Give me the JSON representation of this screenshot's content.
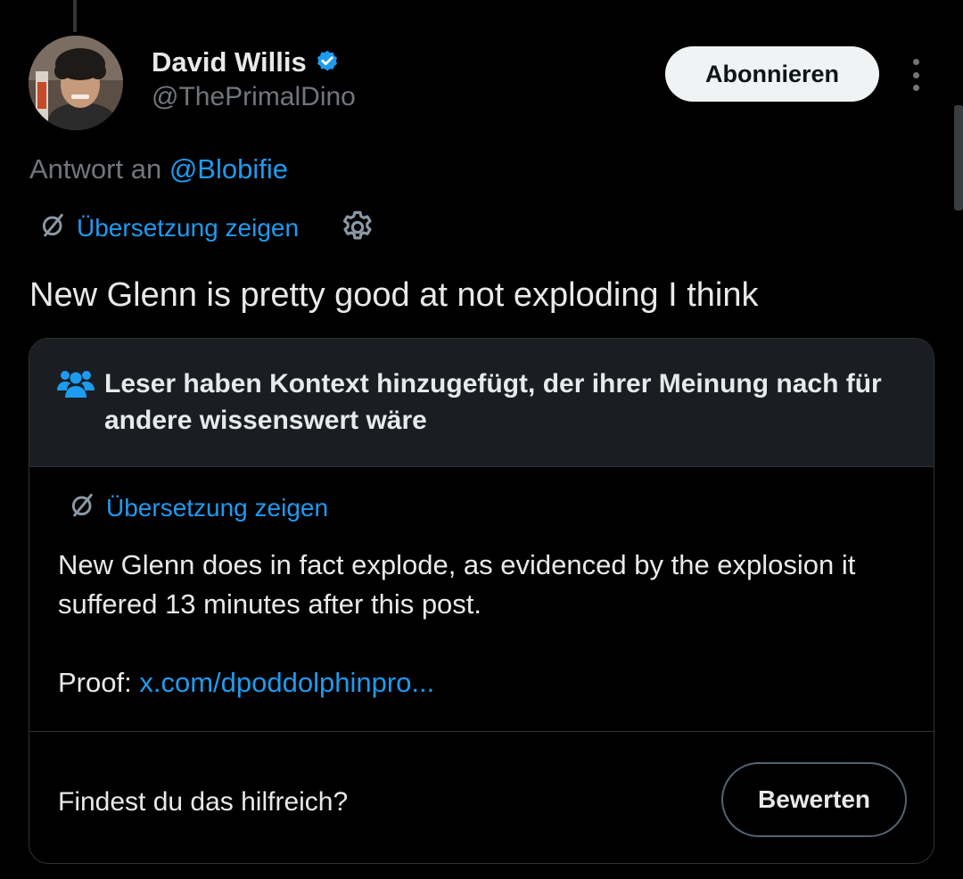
{
  "post": {
    "author_name": "David Willis",
    "handle": "@ThePrimalDino",
    "follow_label": "Abonnieren",
    "reply_prefix": "Antwort an",
    "reply_mention": "@Blobifie",
    "translate_label": "Übersetzung zeigen",
    "text": "New Glenn is pretty good at not exploding I think"
  },
  "community_note": {
    "title": "Leser haben Kontext hinzugefügt, der ihrer Meinung nach für andere wissenswert wäre",
    "translate_label": "Übersetzung zeigen",
    "body": "New Glenn does in fact explode, as evidenced by the explosion it suffered 13 minutes after this post.",
    "proof_label": "Proof:",
    "proof_link": "x.com/dpoddolphinpro...",
    "helpful_question": "Findest du das hilfreich?",
    "rate_label": "Bewerten"
  },
  "icons": {
    "verified": "verified-badge-icon",
    "more": "more-options-icon",
    "translate": "translate-icon",
    "settings": "gear-icon",
    "people": "people-icon"
  },
  "colors": {
    "background": "#000000",
    "text": "#e7e9ea",
    "muted": "#71767b",
    "accent": "#1d9bf0",
    "note_header_bg": "#1a1d22"
  }
}
